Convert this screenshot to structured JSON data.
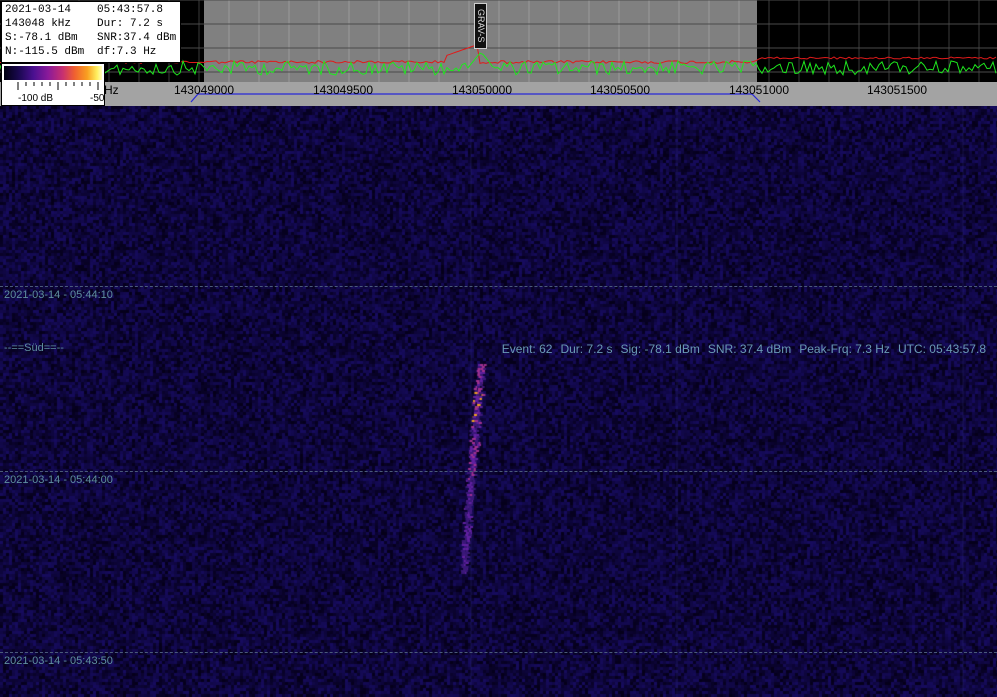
{
  "info": {
    "date": "2021-03-14",
    "time": "05:43:57.8",
    "frequency": "143048 kHz",
    "duration": "Dur: 7.2 s",
    "signal": "S:-78.1 dBm",
    "snr": "SNR:37.4 dBm",
    "noise": "N:-115.5 dBm",
    "df": "df:7.3 Hz"
  },
  "colorbar": {
    "min_label": "-100 dB",
    "max_label": "-50"
  },
  "frequency_axis": {
    "unit_label": "Hz",
    "ticks": [
      "143049000",
      "143049500",
      "143050000",
      "143050500",
      "143051000",
      "143051500"
    ]
  },
  "marker": {
    "label": "GRAV-S"
  },
  "waterfall": {
    "time_labels": [
      "2021-03-14 - 05:44:10",
      "2021-03-14 - 05:44:00",
      "2021-03-14 - 05:43:50"
    ],
    "station": "--==Süd==--",
    "event": {
      "event": "Event: 62",
      "dur": "Dur: 7.2 s",
      "sig": "Sig: -78.1 dBm",
      "snr": "SNR: 37.4 dBm",
      "peak": "Peak-Frq: 7.3 Hz",
      "utc": "UTC: 05:43:57.8"
    }
  },
  "colors": {
    "spectrum_trace": "#1ee81e",
    "average_trace": "#e01a1a",
    "passband": "#2828d8",
    "waterfall_bg": "#0a0a28"
  }
}
